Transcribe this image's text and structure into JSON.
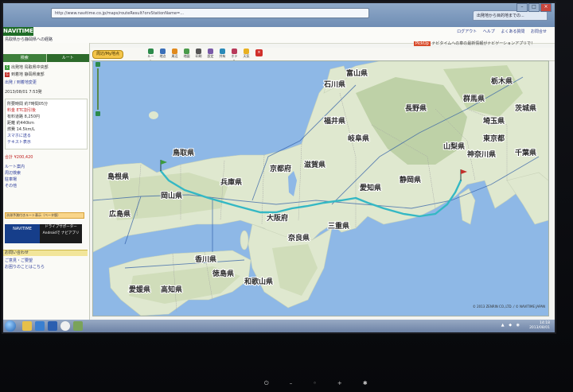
{
  "browser": {
    "address": "http://www.navitime.co.jp/maps/routeResult?orvStationName=...",
    "tab_label": "出発地から目的地までの...",
    "window_buttons": [
      "–",
      "□",
      "×"
    ]
  },
  "site": {
    "logo": "NAVITIME",
    "title": "鳥取県から静岡県への経路",
    "top_links": [
      "ログアウト",
      "ヘルプ",
      "よくある質問",
      "お問合せ"
    ],
    "pickup_badge": "PickUp",
    "pickup_text": "ナビタイムへの車の最新情報がナビゲーションアプリで！"
  },
  "toolbar": {
    "route_pill": "周辺/My地点",
    "tools": [
      "ルート",
      "地点",
      "周辺",
      "地図",
      "印刷",
      "設定",
      "共有",
      "ホテル",
      "天気"
    ],
    "stop": "×"
  },
  "left_panel": {
    "tab_search": "検索",
    "tab_route": "ルート",
    "lines": [
      {
        "text": "出発地 鳥取県中央部",
        "style": "normal"
      },
      {
        "text": "到着地 静岡県東部",
        "style": "normal"
      },
      {
        "text": "出発 / 到着地変更",
        "style": "blue"
      },
      {
        "text": "2013/08/01 7:53発",
        "style": "normal"
      },
      {
        "text": "所要時間 約7時間05分",
        "style": "normal"
      },
      {
        "text": "料金 ETC割引後",
        "style": "red"
      },
      {
        "text": "有料道路 8,250円",
        "style": "normal"
      },
      {
        "text": "距離 約440km",
        "style": "normal"
      },
      {
        "text": "燃費 14.5km/L",
        "style": "normal"
      },
      {
        "text": "スマホに送る",
        "style": "blue"
      },
      {
        "text": "テキスト表示",
        "style": "blue"
      }
    ],
    "toll_total": "合計 ¥200,420",
    "route_links": [
      "ルート案内",
      "周辺検索",
      "駐車場",
      "その他"
    ],
    "orange_bar": "渋滞予測付きルート表示（ベータ版）",
    "banner_navitime": "NAVITIME",
    "banner_drive_title": "ドライブサポーター",
    "banner_drive_sub": "Androidで ナビアプリ",
    "inquiry_head": "お問い合わせ",
    "inquiry_lines": [
      "ご意見・ご要望",
      "お困りのことはこちら"
    ]
  },
  "map": {
    "labels": [
      {
        "name": "石川県"
      },
      {
        "name": "富山県"
      },
      {
        "name": "福井県"
      },
      {
        "name": "岐阜県"
      },
      {
        "name": "長野県"
      },
      {
        "name": "群馬県"
      },
      {
        "name": "栃木県"
      },
      {
        "name": "茨城県"
      },
      {
        "name": "埼玉県"
      },
      {
        "name": "東京都"
      },
      {
        "name": "千葉県"
      },
      {
        "name": "神奈川県"
      },
      {
        "name": "山梨県"
      },
      {
        "name": "静岡県"
      },
      {
        "name": "愛知県"
      },
      {
        "name": "三重県"
      },
      {
        "name": "滋賀県"
      },
      {
        "name": "京都府"
      },
      {
        "name": "奈良県"
      },
      {
        "name": "大阪府"
      },
      {
        "name": "兵庫県"
      },
      {
        "name": "和歌山県"
      },
      {
        "name": "鳥取県"
      },
      {
        "name": "島根県"
      },
      {
        "name": "岡山県"
      },
      {
        "name": "広島県"
      },
      {
        "name": "香川県"
      },
      {
        "name": "徳島県"
      },
      {
        "name": "愛媛県"
      },
      {
        "name": "高知県"
      }
    ],
    "copyright": "© 2013 ZENRIN CO.,LTD. / © NAVITIME JAPAN"
  },
  "taskbar": {
    "time": "14:18",
    "date": "2013/08/01",
    "tray": "▲ ◆ ◉"
  },
  "bezel": {
    "buttons": "⏻ – ◦ + ✱"
  },
  "colors": {
    "sea": "#8eb8e6",
    "land": "#dfe8cf",
    "mountain": "#b8cca0",
    "route": "#34b8c4",
    "brand_green": "#2d6a2b"
  }
}
